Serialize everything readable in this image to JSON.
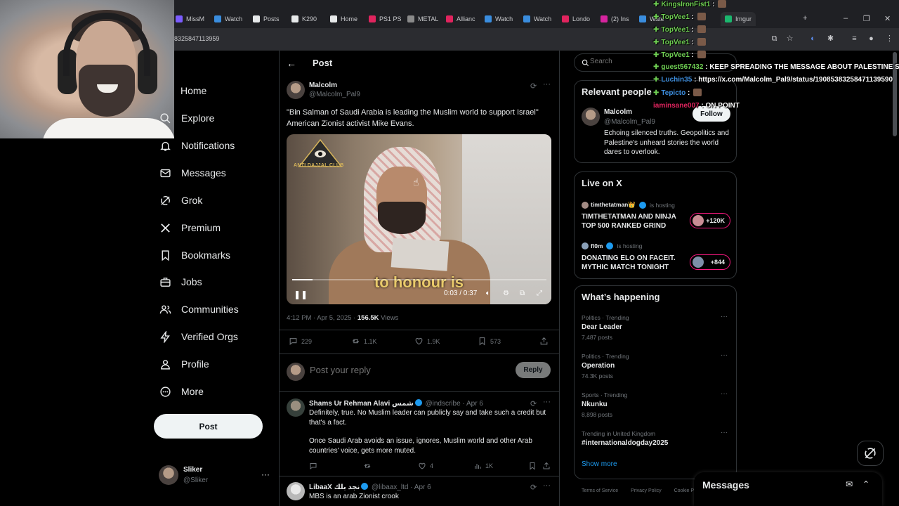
{
  "browser": {
    "tabs": [
      {
        "label": "MissM",
        "color": "#7b5cff"
      },
      {
        "label": "Watch",
        "color": "#3a8dde"
      },
      {
        "label": "Posts",
        "color": "#e7e9ea"
      },
      {
        "label": "K290",
        "color": "#e7e9ea"
      },
      {
        "label": "Home",
        "color": "#e7e9ea"
      },
      {
        "label": "PS1 PS",
        "color": "#e0245e"
      },
      {
        "label": "METAL",
        "color": "#8a8a8a"
      },
      {
        "label": "Allianc",
        "color": "#e0245e"
      },
      {
        "label": "Watch",
        "color": "#3a8dde"
      },
      {
        "label": "Watch",
        "color": "#3a8dde"
      },
      {
        "label": "Londo",
        "color": "#e0245e"
      },
      {
        "label": "(2) Ins",
        "color": "#d6249f"
      },
      {
        "label": "Wate",
        "color": "#3a8dde"
      },
      {
        "label": "Imgur",
        "color": "#1bb76e"
      }
    ],
    "url_fragment": "8325847113959"
  },
  "nav": {
    "items": [
      {
        "label": "Home",
        "icon": "home-icon"
      },
      {
        "label": "Explore",
        "icon": "search-icon"
      },
      {
        "label": "Notifications",
        "icon": "bell-icon"
      },
      {
        "label": "Messages",
        "icon": "envelope-icon"
      },
      {
        "label": "Grok",
        "icon": "grok-icon"
      },
      {
        "label": "Premium",
        "icon": "x-logo-icon"
      },
      {
        "label": "Bookmarks",
        "icon": "bookmark-icon"
      },
      {
        "label": "Jobs",
        "icon": "briefcase-icon"
      },
      {
        "label": "Communities",
        "icon": "people-icon"
      },
      {
        "label": "Verified Orgs",
        "icon": "lightning-icon"
      },
      {
        "label": "Profile",
        "icon": "person-icon"
      },
      {
        "label": "More",
        "icon": "more-circle-icon"
      }
    ],
    "post_label": "Post",
    "account": {
      "name": "Sliker",
      "handle": "@Sliker"
    }
  },
  "main": {
    "header_title": "Post",
    "tweet": {
      "author_name": "Malcolm",
      "author_handle": "@Malcolm_Pal9",
      "text": "\"Bin Salman of Saudi Arabia is leading the Muslim world to support Israel\" American Zionist activist Mike Evans.",
      "video": {
        "watermark": "ANTI DAJJAL CLUB",
        "caption": "to honour is",
        "time": "0:03 / 0:37",
        "progress": 0.08
      },
      "time": "4:12 PM · Apr 5, 2025",
      "views_count": "156.5K",
      "views_label": "Views",
      "stats": {
        "replies": "229",
        "reposts": "1.1K",
        "likes": "1.9K",
        "bookmarks": "573"
      }
    },
    "reply_box": {
      "placeholder": "Post your reply",
      "button": "Reply"
    },
    "replies": [
      {
        "name": "Shams Ur Rehman Alavi شمس",
        "handle": "@indscribe · Apr 6",
        "text_1": "Definitely, true. No Muslim leader can publicly say and take such a credit but that's a fact.",
        "text_2": "Once Saudi Arab avoids an issue, ignores, Muslim world and other Arab countries' voice, gets more muted.",
        "likes": "4",
        "views": "1K"
      },
      {
        "name": "LibaaX نجد بلك",
        "handle": "@libaax_ltd · Apr 6",
        "text_1": "MBS is an arab Zionist crook"
      }
    ]
  },
  "right": {
    "search_placeholder": "Search",
    "relevant": {
      "title": "Relevant people",
      "name": "Malcolm",
      "handle": "@Malcolm_Pal9",
      "follow": "Follow",
      "bio": "Echoing silenced truths. Geopolitics and Palestine's unheard stories the world dares to overlook."
    },
    "live": {
      "title": "Live on X",
      "items": [
        {
          "host": "timthetatman👑",
          "status": "is hosting",
          "title": "TIMTHETATMAN AND NINJA TOP 500 RANKED GRIND",
          "count": "+120K"
        },
        {
          "host": "fl0m",
          "status": "is hosting",
          "title": "DONATING ELO ON FACEIT. MYTHIC MATCH TONIGHT",
          "count": "+844"
        }
      ]
    },
    "trends": {
      "title": "What’s happening",
      "items": [
        {
          "category": "Politics · Trending",
          "name": "Dear Leader",
          "count": "7,487 posts"
        },
        {
          "category": "Politics · Trending",
          "name": "Operation",
          "count": "74.3K posts"
        },
        {
          "category": "Sports · Trending",
          "name": "Nkunku",
          "count": "8,898 posts"
        },
        {
          "category": "Trending in United Kingdom",
          "name": "#internationaldogday2025",
          "count": ""
        }
      ],
      "show_more": "Show more"
    },
    "footer": [
      "Terms of Service",
      "Privacy Policy",
      "Cookie P"
    ],
    "messages_drawer": "Messages"
  },
  "chat": [
    {
      "user": "KingsIronFist1",
      "msg": "",
      "color": "#6fd053"
    },
    {
      "user": "TopVee1",
      "msg": "",
      "color": "#6fd053"
    },
    {
      "user": "TopVee1",
      "msg": "",
      "color": "#6fd053"
    },
    {
      "user": "TopVee1",
      "msg": "",
      "color": "#6fd053"
    },
    {
      "user": "TopVee1",
      "msg": "",
      "color": "#6fd053"
    },
    {
      "user": "guest567432",
      "msg": "KEEP SPREADING THE MESSAGE ABOUT PALESTINE SLIK",
      "color": "#6fd053"
    },
    {
      "user": "Luchin35",
      "msg": "https://x.com/Malcolm_Pal9/status/19085383258471139590",
      "color": "#3d8fe0"
    },
    {
      "user": "Tepicto",
      "msg": "",
      "color": "#3d8fe0"
    },
    {
      "user": "iaminsane007",
      "msg": "ON POINT",
      "color": "#e0245e"
    }
  ]
}
